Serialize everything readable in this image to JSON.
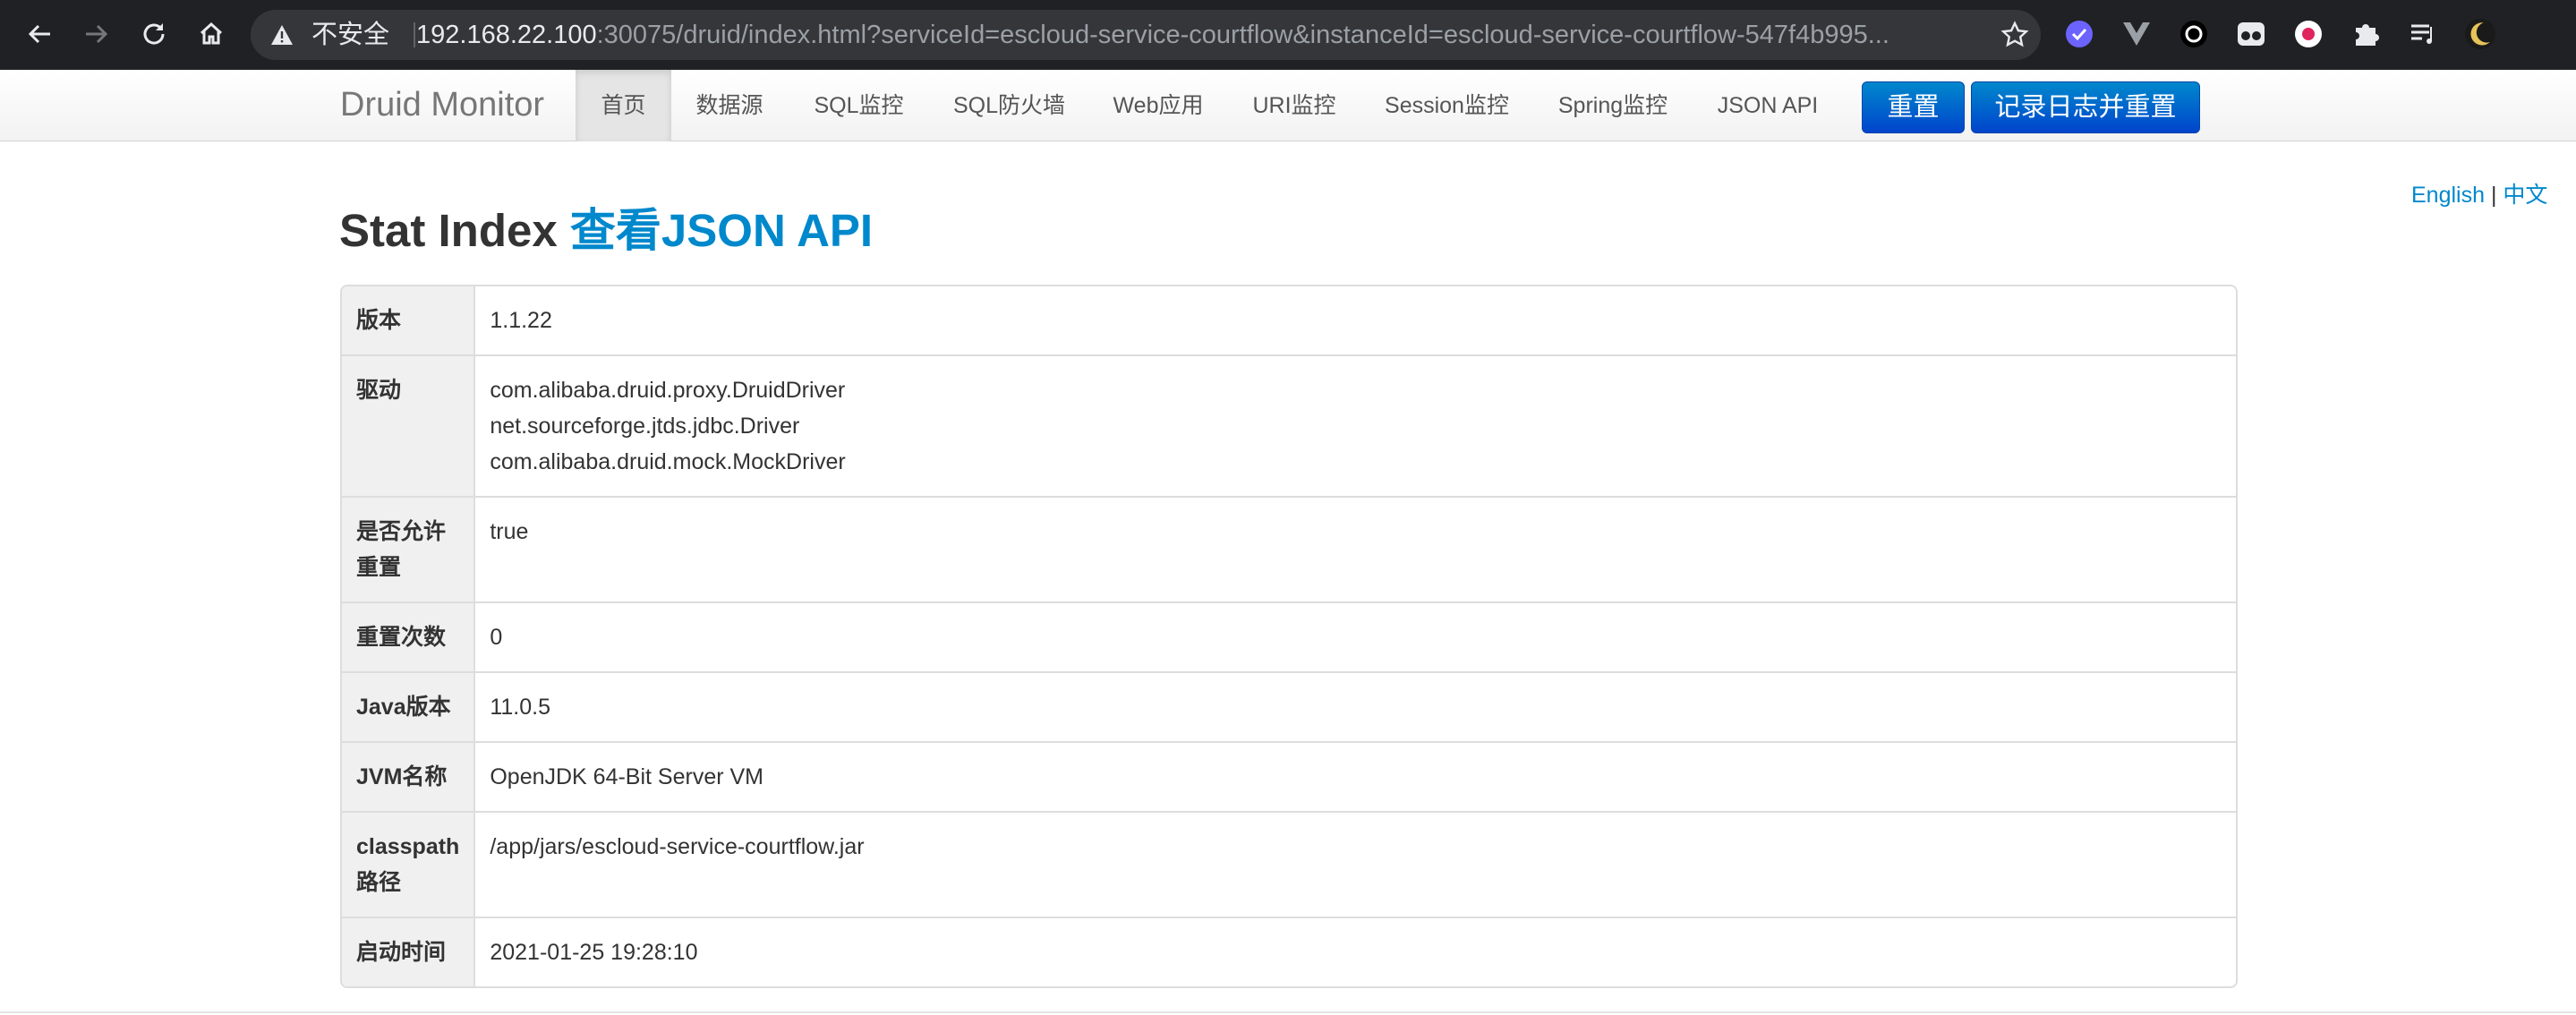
{
  "browser": {
    "insecure_label": "不安全",
    "url_host": "192.168.22.100",
    "url_rest": ":30075/druid/index.html?serviceId=escloud-service-courtflow&instanceId=escloud-service-courtflow-547f4b995..."
  },
  "navbar": {
    "brand": "Druid Monitor",
    "items": [
      "首页",
      "数据源",
      "SQL监控",
      "SQL防火墙",
      "Web应用",
      "URI监控",
      "Session监控",
      "Spring监控",
      "JSON API"
    ],
    "reset_label": "重置",
    "log_reset_label": "记录日志并重置"
  },
  "lang": {
    "english": "English",
    "separator": "|",
    "chinese": "中文"
  },
  "page": {
    "title": "Stat Index",
    "json_link": "查看JSON API"
  },
  "stats": [
    {
      "key": "版本",
      "value": [
        "1.1.22"
      ]
    },
    {
      "key": "驱动",
      "value": [
        "com.alibaba.druid.proxy.DruidDriver",
        "net.sourceforge.jtds.jdbc.Driver",
        "com.alibaba.druid.mock.MockDriver"
      ]
    },
    {
      "key": "是否允许重置",
      "value": [
        "true"
      ]
    },
    {
      "key": "重置次数",
      "value": [
        "0"
      ]
    },
    {
      "key": "Java版本",
      "value": [
        "11.0.5"
      ]
    },
    {
      "key": "JVM名称",
      "value": [
        "OpenJDK 64-Bit Server VM"
      ]
    },
    {
      "key": "classpath路径",
      "value": [
        "/app/jars/escloud-service-courtflow.jar"
      ]
    },
    {
      "key": "启动时间",
      "value": [
        "2021-01-25 19:28:10"
      ]
    }
  ],
  "colors": {
    "accent": "#0088cc",
    "button": "#0044cc",
    "chrome": "#202124"
  }
}
